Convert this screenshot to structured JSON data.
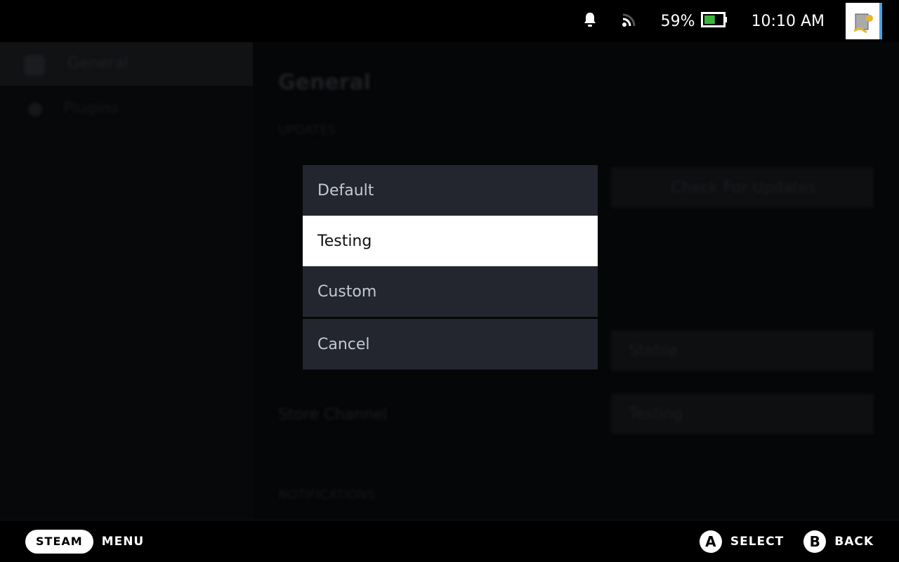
{
  "status_bar": {
    "battery": "59%",
    "battery_level": 0.59,
    "time": "10:10 AM",
    "battery_color": "#3cb43c"
  },
  "sidebar": {
    "items": [
      {
        "label": "General"
      },
      {
        "label": "Plugins"
      }
    ]
  },
  "content": {
    "title": "General",
    "updates_header": "UPDATES",
    "check_updates": "Check For Updates",
    "update_channel_value": "Stable",
    "store_channel_label": "Store Channel",
    "store_channel_value": "Testing",
    "notifications_header": "NOTIFICATIONS"
  },
  "dropdown": {
    "options": [
      "Default",
      "Testing",
      "Custom"
    ],
    "selected": "Testing",
    "cancel": "Cancel"
  },
  "footer": {
    "steam": "STEAM",
    "menu": "MENU",
    "a": "A",
    "select": "SELECT",
    "b": "B",
    "back": "BACK"
  }
}
